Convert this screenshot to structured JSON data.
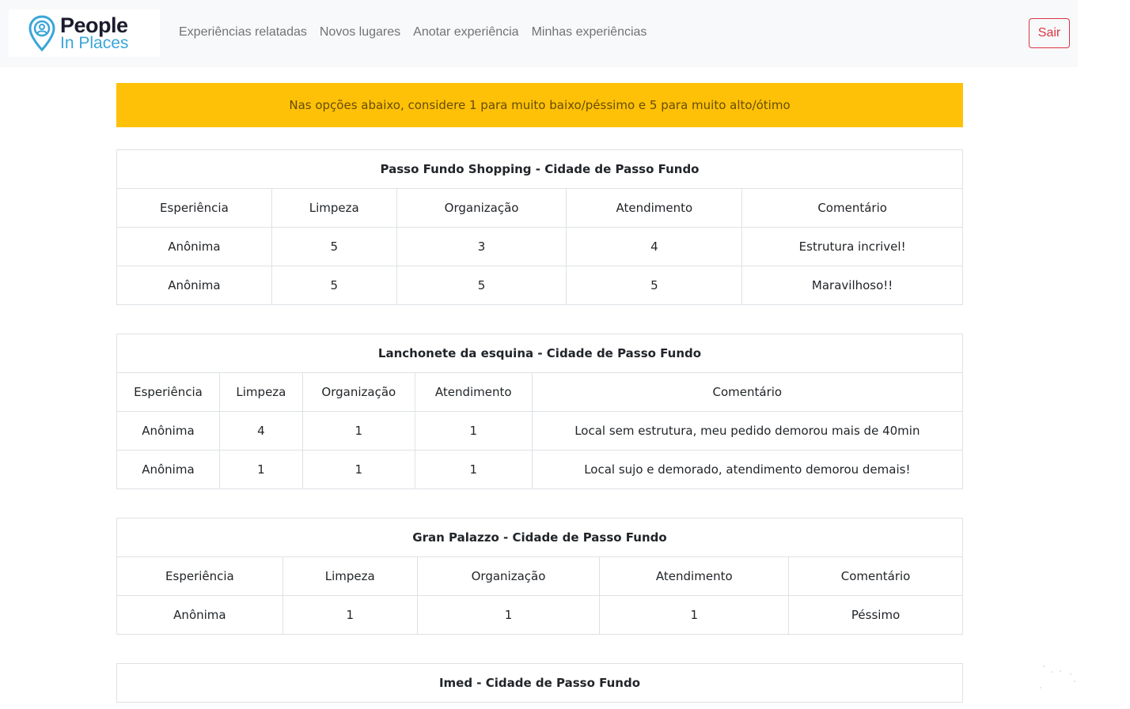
{
  "brand": {
    "line1": "People",
    "line2": "In Places"
  },
  "nav": {
    "links": [
      "Experiências relatadas",
      "Novos lugares",
      "Anotar experiência",
      "Minhas experiências"
    ],
    "exit_label": "Sair"
  },
  "alert": {
    "text": "Nas opções abaixo, considere 1 para muito baixo/péssimo e 5 para muito alto/ótimo"
  },
  "headers": {
    "experience": "Esperiência",
    "cleanliness": "Limpeza",
    "organization": "Organização",
    "service": "Atendimento",
    "comment": "Comentário"
  },
  "places": [
    {
      "name": "Passo Fundo Shopping",
      "separator": " - ",
      "city": "Cidade de Passo Fundo",
      "rows": [
        {
          "experience": "Anônima",
          "cleanliness": "5",
          "organization": "3",
          "service": "4",
          "comment": "Estrutura incrivel!"
        },
        {
          "experience": "Anônima",
          "cleanliness": "5",
          "organization": "5",
          "service": "5",
          "comment": "Maravilhoso!!"
        }
      ]
    },
    {
      "name": "Lanchonete da esquina",
      "separator": " - ",
      "city": "Cidade de Passo Fundo",
      "rows": [
        {
          "experience": "Anônima",
          "cleanliness": "4",
          "organization": "1",
          "service": "1",
          "comment": "Local sem estrutura, meu pedido demorou mais de 40min"
        },
        {
          "experience": "Anônima",
          "cleanliness": "1",
          "organization": "1",
          "service": "1",
          "comment": "Local sujo e demorado, atendimento demorou demais!"
        }
      ]
    },
    {
      "name": "Gran Palazzo",
      "separator": " - ",
      "city": "Cidade de Passo Fundo",
      "rows": [
        {
          "experience": "Anônima",
          "cleanliness": "1",
          "organization": "1",
          "service": "1",
          "comment": "Péssimo"
        }
      ]
    },
    {
      "name": "Imed",
      "separator": " - ",
      "city": "Cidade de Passo Fundo",
      "rows": []
    }
  ],
  "colors": {
    "navbar_bg": "#f8f9fa",
    "alert_bg": "#ffc107",
    "exit_button": "#dc3545",
    "brand_dark": "#1b1b2e",
    "brand_blue": "#3aa5d9"
  }
}
